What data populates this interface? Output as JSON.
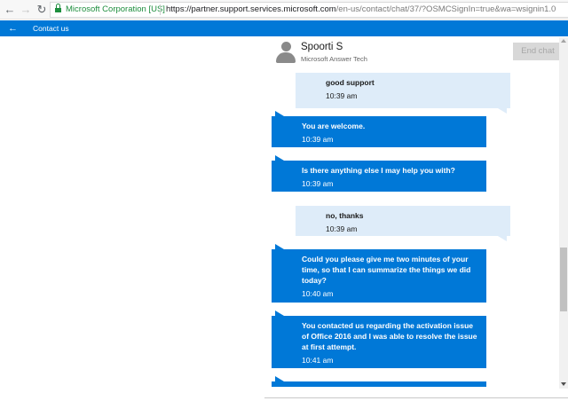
{
  "browser": {
    "secure_label": "Microsoft Corporation [US]",
    "url_host": "https://partner.support.services.microsoft.com",
    "url_path": "/en-us/contact/chat/37/?OSMCSignIn=true&wa=wsignin1.0"
  },
  "appbar": {
    "back_icon": "←",
    "title": "Contact us"
  },
  "chat_header": {
    "agent_name": "Spoorti S",
    "agent_role": "Microsoft Answer Tech",
    "end_chat_label": "End chat"
  },
  "messages": [
    {
      "sender": "user",
      "text": "good support",
      "time": "10:39 am"
    },
    {
      "sender": "agent",
      "text": "You are welcome.",
      "time": "10:39 am"
    },
    {
      "sender": "agent",
      "text": "Is there anything else I may help you with?",
      "time": "10:39 am"
    },
    {
      "sender": "user",
      "text": "no, thanks",
      "time": "10:39 am"
    },
    {
      "sender": "agent",
      "text": "Could you please give me two minutes of your time, so that I can summarize the things we did today?",
      "time": "10:40 am"
    },
    {
      "sender": "agent",
      "text": "You contacted us regarding the activation issue of Office 2016 and I was able to resolve the issue at first attempt.",
      "time": "10:41 am"
    }
  ],
  "colors": {
    "accent": "#0078d7",
    "user_bubble": "#deecf9",
    "secure_green": "#1e8e3e"
  }
}
